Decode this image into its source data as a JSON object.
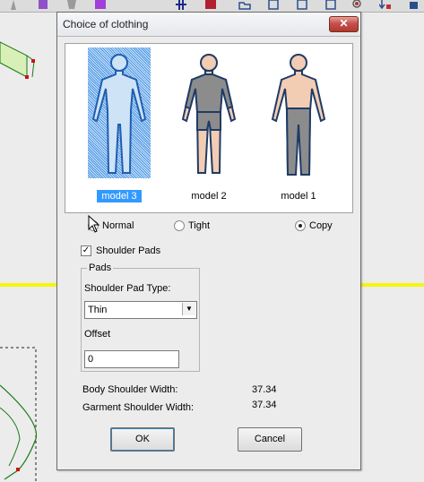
{
  "dialog": {
    "title": "Choice of clothing",
    "close_symbol": "✕"
  },
  "models": [
    {
      "label": "model 3",
      "selected": true
    },
    {
      "label": "model 2",
      "selected": false
    },
    {
      "label": "model 1",
      "selected": false
    }
  ],
  "fit_options": [
    {
      "label": "Normal",
      "checked": false
    },
    {
      "label": "Tight",
      "checked": false
    },
    {
      "label": "Copy",
      "checked": true
    }
  ],
  "shoulder_pads": {
    "label": "Shoulder Pads",
    "checked": true
  },
  "pads": {
    "legend": "Pads",
    "type_label": "Shoulder Pad Type:",
    "type_value": "Thin",
    "offset_label": "Offset",
    "offset_value": "0"
  },
  "measurements": {
    "body_label": "Body Shoulder Width:",
    "body_value": "37.34",
    "garment_label": "Garment Shoulder Width:",
    "garment_value": "37.34"
  },
  "buttons": {
    "ok": "OK",
    "cancel": "Cancel"
  },
  "colors": {
    "selection": "#3399ff",
    "skin": "#f2cdb3",
    "garment_gray": "#8c8c8c",
    "outline_navy": "#1f3b66",
    "close_red": "#c75050",
    "yellow_guide": "#f5f50f"
  }
}
